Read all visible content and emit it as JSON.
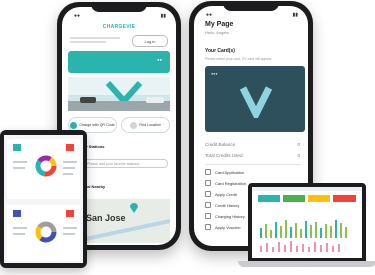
{
  "phone_left": {
    "brand": "CHARGEVIE",
    "login_label": "Log in",
    "actions": [
      {
        "label": "Charge with QR Code"
      },
      {
        "label": "Find Location"
      }
    ],
    "section_stations": "My Stations",
    "search_placeholder": "Please add your favorite stations",
    "section_nearby": "Find Nearby",
    "map_city": "San Jose"
  },
  "phone_right": {
    "title": "My Page",
    "greeting": "Hello, Angela",
    "cards_heading": "Your Card(s)",
    "cards_hint": "Please select your card. EV card will appear.",
    "stat_rows": [
      {
        "label": "Credit Balance",
        "value": "0"
      },
      {
        "label": "Total Credits Used",
        "value": "0"
      }
    ],
    "menu": [
      {
        "label": "Card Application"
      },
      {
        "label": "Card Registration"
      },
      {
        "label": "Apply Credit"
      },
      {
        "label": "Credit History"
      },
      {
        "label": "Charging History"
      },
      {
        "label": "Apply Voucher"
      }
    ]
  },
  "colors": {
    "brand_teal": "#2bb3ad",
    "card_dark": "#2e4f5c",
    "tile_colors": [
      "#2bb3ad",
      "#4caf50",
      "#ffc107",
      "#f44336"
    ]
  }
}
